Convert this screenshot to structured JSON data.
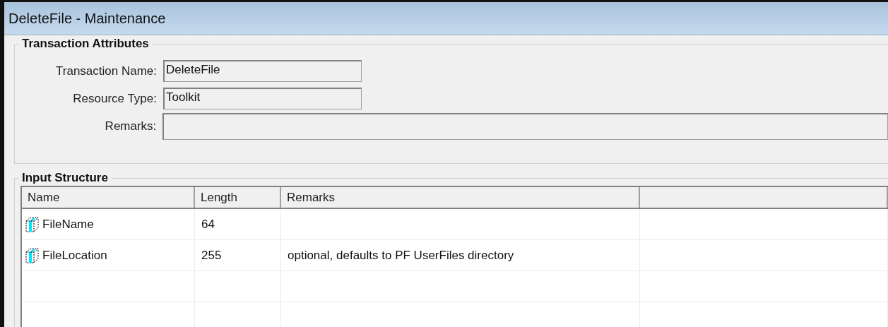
{
  "window": {
    "title": "DeleteFile - Maintenance"
  },
  "transaction_attributes": {
    "title": "Transaction Attributes",
    "fields": [
      {
        "label": "Transaction Name:",
        "value": "DeleteFile",
        "wide": false
      },
      {
        "label": "Resource Type:",
        "value": "Toolkit",
        "wide": false
      },
      {
        "label": "Remarks:",
        "wide": true
      }
    ]
  },
  "input_structure": {
    "title": "Input Structure",
    "columns": [
      "Name",
      "Length",
      "Remarks"
    ],
    "rows": [
      {
        "name": "FileName",
        "length": "64"
      },
      {
        "name": "FileLocation",
        "length": "255",
        "remarks": "optional, defaults to PF UserFiles directory"
      }
    ]
  }
}
